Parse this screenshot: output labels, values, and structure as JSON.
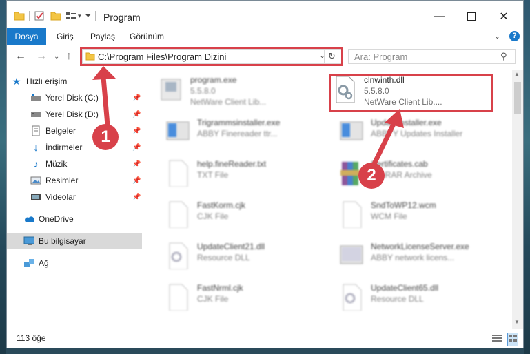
{
  "window": {
    "title": "Program"
  },
  "ribbon": {
    "tabs": [
      "Dosya",
      "Giriş",
      "Paylaş",
      "Görünüm"
    ]
  },
  "address": {
    "path": "C:\\Program Files\\Program Dizini"
  },
  "search": {
    "placeholder": "Ara: Program"
  },
  "sidebar": {
    "quick_access": "Hızlı erişim",
    "items": [
      {
        "label": "Yerel Disk (C:)"
      },
      {
        "label": "Yerel Disk (D:)"
      },
      {
        "label": "Belgeler"
      },
      {
        "label": "İndirmeler"
      },
      {
        "label": "Müzik"
      },
      {
        "label": "Resimler"
      },
      {
        "label": "Videolar"
      }
    ],
    "onedrive": "OneDrive",
    "this_pc": "Bu bilgisayar",
    "network": "Ağ"
  },
  "files": [
    {
      "name": "program.exe",
      "line2": "5.5.8.0",
      "line3": "NetWare Client Lib..."
    },
    {
      "name": "clnwinth.dll",
      "line2": "5.5.8.0",
      "line3": "NetWare Client Lib...."
    },
    {
      "name": "Trigrammsinstaller.exe",
      "line2": "ABBY Finereader ttr...",
      "line3": ""
    },
    {
      "name": "UpdateInstaller.exe",
      "line2": "ABBYY Updates Installer",
      "line3": ""
    },
    {
      "name": "help.fineReader.txt",
      "line2": "TXT File",
      "line3": ""
    },
    {
      "name": "Certificates.cab",
      "line2": "WinRAR Archive",
      "line3": ""
    },
    {
      "name": "FastKorm.cjk",
      "line2": "CJK File",
      "line3": ""
    },
    {
      "name": "SndToWP12.wcm",
      "line2": "WCM File",
      "line3": ""
    },
    {
      "name": "UpdateClient21.dll",
      "line2": "Resource DLL",
      "line3": ""
    },
    {
      "name": "NetworkLicenseServer.exe",
      "line2": "ABBY network licens...",
      "line3": ""
    },
    {
      "name": "FastNrml.cjk",
      "line2": "CJK File",
      "line3": ""
    },
    {
      "name": "UpdateClient65.dll",
      "line2": "Resource DLL",
      "line3": ""
    }
  ],
  "status": {
    "count": "113 öğe"
  },
  "annotations": {
    "step1": "1",
    "step2": "2"
  },
  "colors": {
    "accent": "#1979ca",
    "highlight": "#d8414a"
  }
}
